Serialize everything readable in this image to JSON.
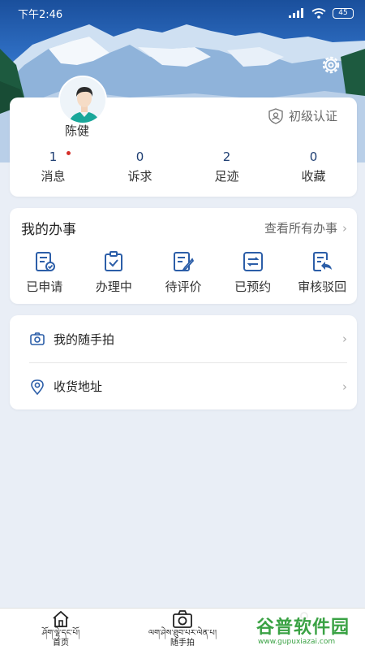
{
  "status_bar": {
    "time": "下午2:46",
    "signal": "signal-icon",
    "wifi": "wifi-icon",
    "battery": "45"
  },
  "profile": {
    "name": "陈健",
    "certification": "初级认证",
    "stats": [
      {
        "value": "1",
        "label": "消息",
        "unread": true
      },
      {
        "value": "0",
        "label": "诉求"
      },
      {
        "value": "2",
        "label": "足迹"
      },
      {
        "value": "0",
        "label": "收藏"
      }
    ]
  },
  "affairs": {
    "title": "我的办事",
    "view_all": "查看所有办事",
    "items": [
      {
        "label": "已申请",
        "icon": "applied-icon"
      },
      {
        "label": "办理中",
        "icon": "processing-icon"
      },
      {
        "label": "待评价",
        "icon": "to-review-icon"
      },
      {
        "label": "已预约",
        "icon": "booked-icon"
      },
      {
        "label": "审核驳回",
        "icon": "rejected-icon"
      }
    ]
  },
  "menu": [
    {
      "label": "我的随手拍",
      "icon": "camera-icon"
    },
    {
      "label": "收货地址",
      "icon": "location-icon"
    }
  ],
  "tabbar": [
    {
      "tib": "ཤོག་ལྷེ་དང་པོ།",
      "zh": "首页",
      "icon": "home-icon"
    },
    {
      "tib": "ལག་ཤེས་ཐུབ་པར་ལེན་པ།",
      "zh": "随手拍",
      "icon": "camera-icon"
    }
  ],
  "watermark": {
    "title": "谷普软件园",
    "url": "www.gupuxiazai.com"
  },
  "colors": {
    "accent": "#2c5ea8",
    "background": "#e9eef6",
    "badge": "#d5302a",
    "watermark": "#3aa244"
  }
}
